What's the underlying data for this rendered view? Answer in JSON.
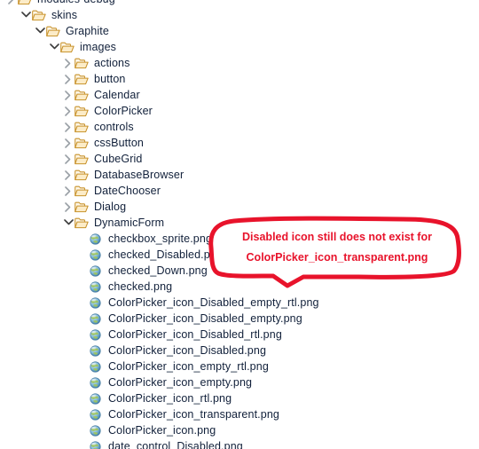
{
  "window": {
    "background": "#ffffff",
    "text_color": "#11203a"
  },
  "tree": {
    "rows": [
      {
        "indent": 0,
        "twisty": "collapsed",
        "icon": "folder-icon",
        "label": "modules-debug",
        "clipped": true
      },
      {
        "indent": 1,
        "twisty": "expanded",
        "icon": "folder-icon",
        "label": "skins"
      },
      {
        "indent": 2,
        "twisty": "expanded",
        "icon": "folder-icon",
        "label": "Graphite"
      },
      {
        "indent": 3,
        "twisty": "expanded",
        "icon": "folder-icon",
        "label": "images"
      },
      {
        "indent": 4,
        "twisty": "collapsed",
        "icon": "folder-icon",
        "label": "actions"
      },
      {
        "indent": 4,
        "twisty": "collapsed",
        "icon": "folder-icon",
        "label": "button"
      },
      {
        "indent": 4,
        "twisty": "collapsed",
        "icon": "folder-icon",
        "label": "Calendar"
      },
      {
        "indent": 4,
        "twisty": "collapsed",
        "icon": "folder-icon",
        "label": "ColorPicker"
      },
      {
        "indent": 4,
        "twisty": "collapsed",
        "icon": "folder-icon",
        "label": "controls"
      },
      {
        "indent": 4,
        "twisty": "collapsed",
        "icon": "folder-icon",
        "label": "cssButton"
      },
      {
        "indent": 4,
        "twisty": "collapsed",
        "icon": "folder-icon",
        "label": "CubeGrid"
      },
      {
        "indent": 4,
        "twisty": "collapsed",
        "icon": "folder-icon",
        "label": "DatabaseBrowser"
      },
      {
        "indent": 4,
        "twisty": "collapsed",
        "icon": "folder-icon",
        "label": "DateChooser"
      },
      {
        "indent": 4,
        "twisty": "collapsed",
        "icon": "folder-icon",
        "label": "Dialog"
      },
      {
        "indent": 4,
        "twisty": "expanded",
        "icon": "folder-icon",
        "label": "DynamicForm"
      },
      {
        "indent": 5,
        "twisty": "none",
        "icon": "globe-icon",
        "label": "checkbox_sprite.png"
      },
      {
        "indent": 5,
        "twisty": "none",
        "icon": "globe-icon",
        "label": "checked_Disabled.png"
      },
      {
        "indent": 5,
        "twisty": "none",
        "icon": "globe-icon",
        "label": "checked_Down.png"
      },
      {
        "indent": 5,
        "twisty": "none",
        "icon": "globe-icon",
        "label": "checked.png"
      },
      {
        "indent": 5,
        "twisty": "none",
        "icon": "globe-icon",
        "label": "ColorPicker_icon_Disabled_empty_rtl.png"
      },
      {
        "indent": 5,
        "twisty": "none",
        "icon": "globe-icon",
        "label": "ColorPicker_icon_Disabled_empty.png"
      },
      {
        "indent": 5,
        "twisty": "none",
        "icon": "globe-icon",
        "label": "ColorPicker_icon_Disabled_rtl.png"
      },
      {
        "indent": 5,
        "twisty": "none",
        "icon": "globe-icon",
        "label": "ColorPicker_icon_Disabled.png"
      },
      {
        "indent": 5,
        "twisty": "none",
        "icon": "globe-icon",
        "label": "ColorPicker_icon_empty_rtl.png"
      },
      {
        "indent": 5,
        "twisty": "none",
        "icon": "globe-icon",
        "label": "ColorPicker_icon_empty.png"
      },
      {
        "indent": 5,
        "twisty": "none",
        "icon": "globe-icon",
        "label": "ColorPicker_icon_rtl.png"
      },
      {
        "indent": 5,
        "twisty": "none",
        "icon": "globe-icon",
        "label": "ColorPicker_icon_transparent.png"
      },
      {
        "indent": 5,
        "twisty": "none",
        "icon": "globe-icon",
        "label": "ColorPicker_icon.png"
      },
      {
        "indent": 5,
        "twisty": "none",
        "icon": "globe-icon",
        "label": "date_control_Disabled.png",
        "clipped": true
      }
    ]
  },
  "annotation": {
    "color": "#e8132b",
    "line1": "Disabled icon still does not exist for",
    "line2": "ColorPicker_icon_transparent.png"
  }
}
